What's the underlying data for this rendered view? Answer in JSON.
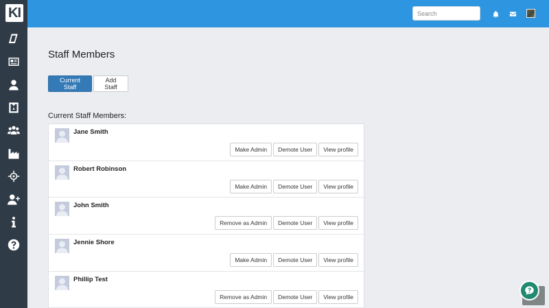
{
  "app": {
    "logo_text": "KI"
  },
  "sidebar": {
    "items": [
      {
        "icon": "book-icon"
      },
      {
        "icon": "newspaper-icon"
      },
      {
        "icon": "user-icon"
      },
      {
        "icon": "badge-icon"
      },
      {
        "icon": "users-icon"
      },
      {
        "icon": "factory-icon"
      },
      {
        "icon": "crosshairs-icon"
      },
      {
        "icon": "user-plus-icon"
      },
      {
        "icon": "info-icon"
      },
      {
        "icon": "question-circle-icon"
      }
    ]
  },
  "topbar": {
    "search_placeholder": "Search",
    "icons": [
      "bell-icon",
      "envelope-icon",
      "user-avatar"
    ]
  },
  "page": {
    "title": "Staff Members",
    "tabs": [
      {
        "label": "Current Staff",
        "active": true
      },
      {
        "label": "Add Staff",
        "active": false
      }
    ],
    "section_label": "Current Staff Members:"
  },
  "members": [
    {
      "name": "Jane Smith",
      "admin_action": "Make Admin",
      "demote": "Demote User",
      "view": "View profile"
    },
    {
      "name": "Robert Robinson",
      "admin_action": "Make Admin",
      "demote": "Demote User",
      "view": "View profile"
    },
    {
      "name": "John Smith",
      "admin_action": "Remove as Admin",
      "demote": "Demote User",
      "view": "View profile"
    },
    {
      "name": "Jennie Shore",
      "admin_action": "Make Admin",
      "demote": "Demote User",
      "view": "View profile"
    },
    {
      "name": "Phillip Test",
      "admin_action": "Remove as Admin",
      "demote": "Demote User",
      "view": "View profile"
    }
  ],
  "colors": {
    "topbar": "#2e96e0",
    "sidebar": "#2f3b47",
    "primary_button": "#337ab7",
    "help_button": "#1f8a70"
  }
}
